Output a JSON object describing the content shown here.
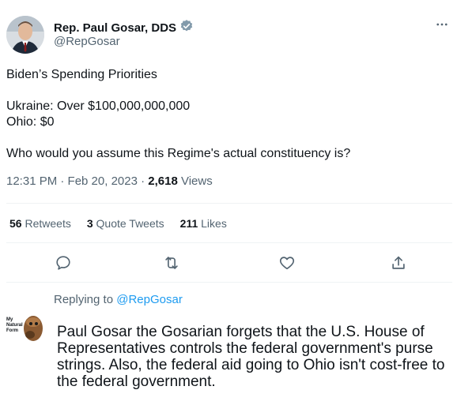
{
  "author": {
    "name": "Rep. Paul Gosar, DDS",
    "handle": "@RepGosar",
    "verified": true
  },
  "tweet": {
    "line1": "Biden’s Spending Priorities",
    "line2": "Ukraine: Over $100,000,000,000",
    "line3": "Ohio: $0",
    "line4": "Who would you assume this Regime's actual constituency is?"
  },
  "meta": {
    "time": "12:31 PM · Feb 20, 2023 · ",
    "views_count": "2,618",
    "views_label": " Views"
  },
  "stats": {
    "retweets_count": "56",
    "retweets_label": "Retweets",
    "quotes_count": "3",
    "quotes_label": "Quote Tweets",
    "likes_count": "211",
    "likes_label": "Likes"
  },
  "icons": {
    "reply": "reply-icon",
    "retweet": "retweet-icon",
    "like": "heart-icon",
    "share": "share-icon",
    "more": "more-icon",
    "verified": "verified-badge-icon"
  },
  "reply": {
    "replying_prefix": "Replying to ",
    "replying_handle": "@RepGosar",
    "avatar_caption": "My Natural Form",
    "text": "Paul Gosar the Gosarian forgets that the U.S. House of Representatives controls the federal government's purse strings. Also, the federal aid going to Ohio isn't cost-free to the federal government."
  },
  "colors": {
    "accent": "#1d9bf0",
    "muted": "#536471",
    "text": "#0f1419"
  }
}
